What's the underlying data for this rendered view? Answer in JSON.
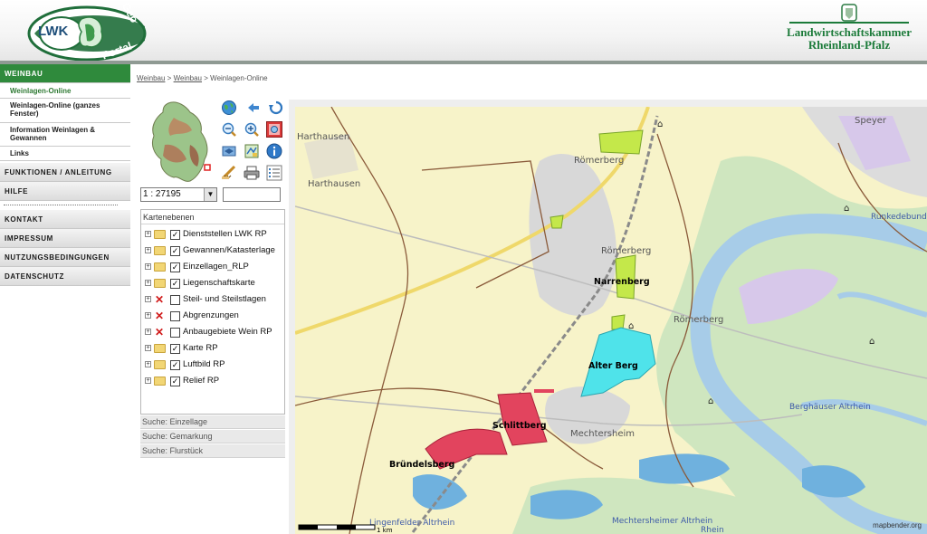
{
  "header": {
    "logo_left": {
      "lwk": "LWK",
      "geo": "Geo",
      "portal": "Portal"
    },
    "logo_right": {
      "line1": "Landwirtschaftskammer",
      "line2": "Rheinland-Pfalz"
    }
  },
  "sidebar": {
    "sections": [
      {
        "label": "WEINBAU",
        "active": true
      },
      {
        "label": "FUNKTIONEN / ANLEITUNG"
      },
      {
        "label": "HILFE"
      },
      {
        "label": "KONTAKT"
      },
      {
        "label": "IMPRESSUM"
      },
      {
        "label": "NUTZUNGSBEDINGUNGEN"
      },
      {
        "label": "DATENSCHUTZ"
      }
    ],
    "weinbau_items": [
      {
        "label": "Weinlagen-Online",
        "active": true
      },
      {
        "label": "Weinlagen-Online (ganzes Fenster)"
      },
      {
        "label": "Information Weinlagen & Gewannen"
      },
      {
        "label": "Links"
      }
    ]
  },
  "breadcrumb": {
    "item1": "Weinbau",
    "sep": ">",
    "item2": "Weinbau",
    "current": "Weinlagen-Online"
  },
  "toolbar": {
    "scale_value": "1 : 27195",
    "search_value": "",
    "icons": [
      "globe-icon",
      "back-arrow-icon",
      "reload-icon",
      "zoom-out-icon",
      "zoom-in-icon",
      "zoom-box-icon",
      "pan-icon",
      "legend-map-icon",
      "info-icon",
      "measure-icon",
      "print-icon",
      "list-icon"
    ]
  },
  "layers": {
    "title": "Kartenebenen",
    "items": [
      {
        "label": "Dienststellen LWK RP",
        "checked": true,
        "icon": "folder"
      },
      {
        "label": "Gewannen/Katasterlage",
        "checked": true,
        "icon": "folder"
      },
      {
        "label": "Einzellagen_RLP",
        "checked": true,
        "icon": "folder"
      },
      {
        "label": "Liegenschaftskarte",
        "checked": true,
        "icon": "folder"
      },
      {
        "label": "Steil- und Steilstlagen",
        "checked": false,
        "icon": "x"
      },
      {
        "label": "Abgrenzungen",
        "checked": false,
        "icon": "x"
      },
      {
        "label": "Anbaugebiete Wein RP",
        "checked": false,
        "icon": "x"
      },
      {
        "label": "Karte RP",
        "checked": true,
        "icon": "folder"
      },
      {
        "label": "Luftbild RP",
        "checked": true,
        "icon": "folder"
      },
      {
        "label": "Relief RP",
        "checked": true,
        "icon": "folder"
      }
    ]
  },
  "search": [
    {
      "label": "Suche: Einzellage"
    },
    {
      "label": "Suche: Gemarkung"
    },
    {
      "label": "Suche: Flurstück"
    }
  ],
  "map": {
    "place_labels": [
      "Harthausen",
      "Harthausen",
      "Römerberg",
      "Römerberg",
      "Römerberg",
      "Mechtersheim",
      "Speyer"
    ],
    "water_labels": [
      "Runkedebund",
      "Berghäuser Altrhein",
      "Mechtersheimer Altrhein",
      "Lingenfelder Altrhein",
      "Rhein"
    ],
    "vineyard_labels": [
      "Narrenberg",
      "Alter Berg",
      "Schlittberg",
      "Bründelsberg"
    ],
    "scalebar_label": "1 km",
    "credit": "mapbender.org",
    "colors": {
      "background": "#f7f3c9",
      "water": "#a7cce8",
      "alter_berg": "#4fe3ea",
      "schlittberg": "#e2445e",
      "narrenberg": "#c4e84a",
      "settlement": "#d8d8d8"
    }
  }
}
